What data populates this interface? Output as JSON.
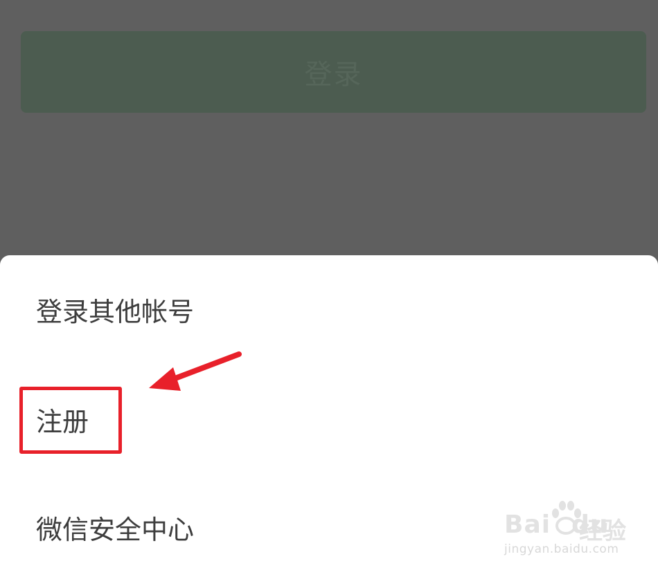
{
  "background_screen": {
    "login_button_label": "登录"
  },
  "action_sheet": {
    "items": [
      {
        "label": "登录其他帐号"
      },
      {
        "label": "注册"
      },
      {
        "label": "微信安全中心"
      }
    ]
  },
  "annotation": {
    "highlight_color": "#e8202a",
    "arrow_color": "#e8202a",
    "arrow_direction": "pointing-left-down"
  },
  "watermark": {
    "brand": "Bai",
    "brand_suffix": "du",
    "brand_cn": "经验",
    "url": "jingyan.baidu.com"
  },
  "colors": {
    "dim_overlay": "#5f5f5f",
    "login_button": "#4c5c50",
    "sheet_bg": "#ffffff",
    "menu_text": "#3d3d3d"
  }
}
